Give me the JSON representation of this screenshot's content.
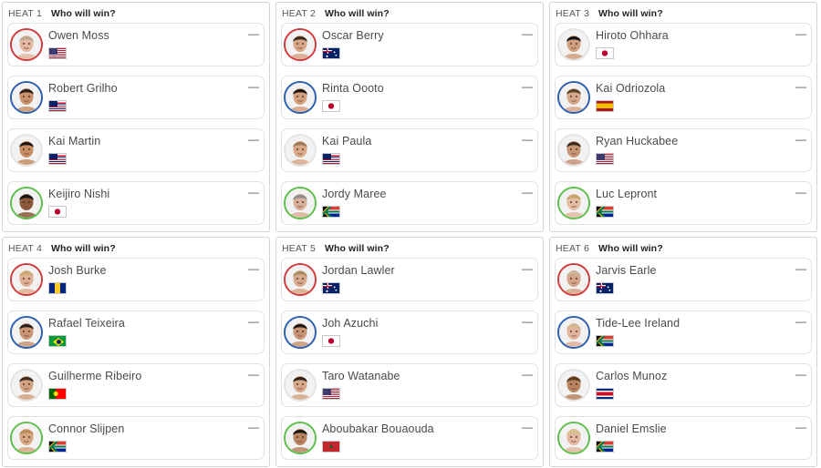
{
  "heats": [
    {
      "label": "HEAT 1",
      "question": "Who will win?",
      "surfers": [
        {
          "name": "Owen Moss",
          "flag": "usa",
          "ring": "red",
          "skin": "#e2b8a0",
          "hair": "#b9a88f",
          "value": "—"
        },
        {
          "name": "Robert Grilho",
          "flag": "haw",
          "ring": "blue",
          "skin": "#c9926c",
          "hair": "#2b1d14",
          "value": "—"
        },
        {
          "name": "Kai Martin",
          "flag": "haw",
          "ring": "white",
          "skin": "#c78d63",
          "hair": "#1c130d",
          "value": "—"
        },
        {
          "name": "Keijiro Nishi",
          "flag": "jpn",
          "ring": "green",
          "skin": "#8c5a3a",
          "hair": "#141414",
          "value": "—"
        }
      ]
    },
    {
      "label": "HEAT 2",
      "question": "Who will win?",
      "surfers": [
        {
          "name": "Oscar Berry",
          "flag": "aus",
          "ring": "red",
          "skin": "#d8a587",
          "hair": "#3a2a1f",
          "value": "—"
        },
        {
          "name": "Rinta Oooto",
          "flag": "jpn",
          "ring": "blue",
          "skin": "#d4a07c",
          "hair": "#1c1410",
          "value": "—"
        },
        {
          "name": "Kai Paula",
          "flag": "haw",
          "ring": "white",
          "skin": "#d9a98a",
          "hair": "#9c7a55",
          "value": "—"
        },
        {
          "name": "Jordy Maree",
          "flag": "rsa",
          "ring": "green",
          "skin": "#d8b099",
          "hair": "#8c8c8c",
          "value": "—"
        }
      ]
    },
    {
      "label": "HEAT 3",
      "question": "Who will win?",
      "surfers": [
        {
          "name": "Hiroto Ohhara",
          "flag": "jpn",
          "ring": "white",
          "skin": "#d0a07e",
          "hair": "#121212",
          "value": "—"
        },
        {
          "name": "Kai Odriozola",
          "flag": "esp",
          "ring": "blue",
          "skin": "#d6a98a",
          "hair": "#5a4026",
          "value": "—"
        },
        {
          "name": "Ryan Huckabee",
          "flag": "usa",
          "ring": "white",
          "skin": "#c89476",
          "hair": "#3a2a1c",
          "value": "—"
        },
        {
          "name": "Luc Lepront",
          "flag": "rsa",
          "ring": "green",
          "skin": "#e3bca3",
          "hair": "#c9a36a",
          "value": "—"
        }
      ]
    },
    {
      "label": "HEAT 4",
      "question": "Who will win?",
      "surfers": [
        {
          "name": "Josh Burke",
          "flag": "brb",
          "ring": "red",
          "skin": "#e0b095",
          "hair": "#caa870",
          "value": "—"
        },
        {
          "name": "Rafael Teixeira",
          "flag": "bra",
          "ring": "blue",
          "skin": "#c99574",
          "hair": "#2a2018",
          "value": "—"
        },
        {
          "name": "Guilherme Ribeiro",
          "flag": "prt",
          "ring": "white",
          "skin": "#d3a283",
          "hair": "#3b2b20",
          "value": "—"
        },
        {
          "name": "Connor Slijpen",
          "flag": "rsa",
          "ring": "green",
          "skin": "#d9a684",
          "hair": "#b88d55",
          "value": "—"
        }
      ]
    },
    {
      "label": "HEAT 5",
      "question": "Who will win?",
      "surfers": [
        {
          "name": "Jordan Lawler",
          "flag": "aus",
          "ring": "red",
          "skin": "#d8a98b",
          "hair": "#a88a60",
          "value": "—"
        },
        {
          "name": "Joh Azuchi",
          "flag": "jpn",
          "ring": "blue",
          "skin": "#c79474",
          "hair": "#1a1410",
          "value": "—"
        },
        {
          "name": "Taro Watanabe",
          "flag": "usa",
          "ring": "white",
          "skin": "#d6a887",
          "hair": "#2c2018",
          "value": "—"
        },
        {
          "name": "Aboubakar Bouaouda",
          "flag": "mar",
          "ring": "green",
          "skin": "#b98362",
          "hair": "#1a1410",
          "value": "—"
        }
      ]
    },
    {
      "label": "HEAT 6",
      "question": "Who will win?",
      "surfers": [
        {
          "name": "Jarvis Earle",
          "flag": "aus",
          "ring": "red",
          "skin": "#d6a48a",
          "hair": "#c6b59a",
          "value": "—"
        },
        {
          "name": "Tide-Lee Ireland",
          "flag": "rsa",
          "ring": "blue",
          "skin": "#e0b49b",
          "hair": "#d2b88e",
          "value": "—"
        },
        {
          "name": "Carlos Munoz",
          "flag": "cri",
          "ring": "white",
          "skin": "#b88360",
          "hair": "#5a3a22",
          "value": "—"
        },
        {
          "name": "Daniel Emslie",
          "flag": "rsa",
          "ring": "green",
          "skin": "#e2b8a0",
          "hair": "#d8c08a",
          "value": "—"
        }
      ]
    }
  ]
}
